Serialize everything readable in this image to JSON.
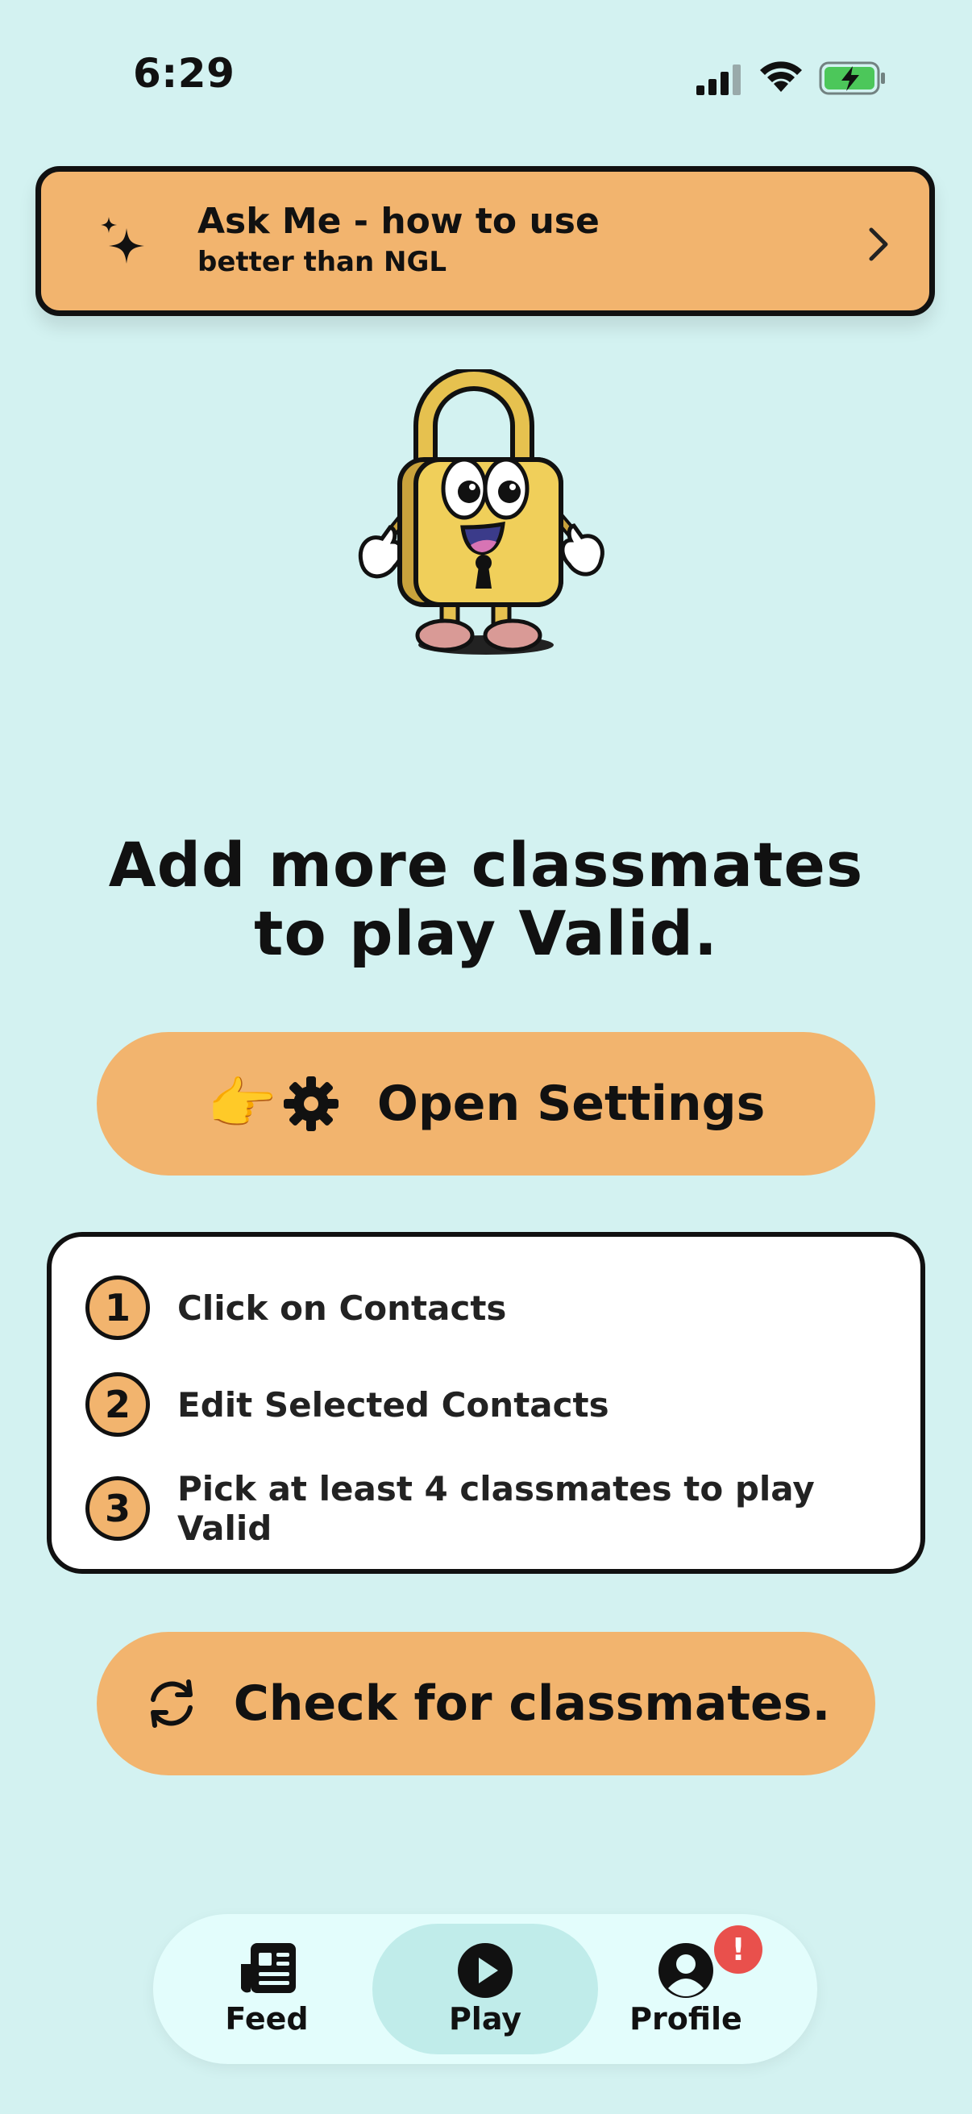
{
  "status_bar": {
    "time": "6:29"
  },
  "banner": {
    "title": "Ask Me - how to use",
    "subtitle": "better than NGL",
    "icon": "sparkle-icon",
    "chevron_icon": "chevron-right-icon"
  },
  "headline": "Add more classmates to play Valid.",
  "settings_button": {
    "emoji": "👉",
    "icon": "gear-icon",
    "label": "Open Settings"
  },
  "steps": [
    {
      "number": "1",
      "label": "Click on Contacts"
    },
    {
      "number": "2",
      "label": "Edit Selected Contacts"
    },
    {
      "number": "3",
      "label": "Pick at least 4 classmates to play Valid"
    }
  ],
  "check_button": {
    "icon": "refresh-icon",
    "label": "Check for classmates."
  },
  "nav": {
    "items": [
      {
        "label": "Feed",
        "icon": "newspaper-icon"
      },
      {
        "label": "Play",
        "icon": "play-icon",
        "active": true
      },
      {
        "label": "Profile",
        "icon": "profile-icon",
        "badge": "!"
      }
    ]
  },
  "colors": {
    "background": "#d3f2f1",
    "accent": "#f2b46e",
    "badge": "#e9504c",
    "nav_active": "#c0ecea"
  }
}
